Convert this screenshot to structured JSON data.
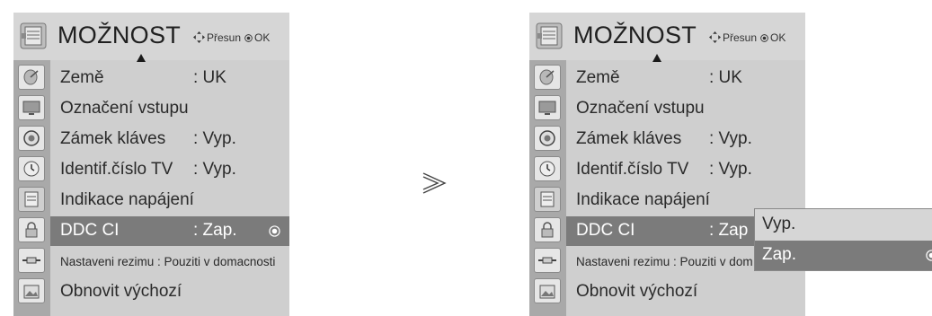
{
  "left_menu": {
    "title": "MOŽNOST",
    "hint_move": "Přesun",
    "hint_ok": "OK",
    "rows": [
      {
        "label": "Země",
        "value": ": UK"
      },
      {
        "label": "Označení vstupu",
        "value": ""
      },
      {
        "label": "Zámek kláves",
        "value": ": Vyp."
      },
      {
        "label": "Identif.číslo TV",
        "value": ": Vyp."
      },
      {
        "label": "Indikace napájení",
        "value": ""
      },
      {
        "label": "DDC CI",
        "value": ": Zap."
      },
      {
        "label": "Nastaveni rezimu : Pouziti v domacnosti",
        "value": ""
      },
      {
        "label": "Obnovit výchozí",
        "value": ""
      }
    ]
  },
  "right_menu": {
    "title": "MOŽNOST",
    "hint_move": "Přesun",
    "hint_ok": "OK",
    "rows": [
      {
        "label": "Země",
        "value": ": UK"
      },
      {
        "label": "Označení vstupu",
        "value": ""
      },
      {
        "label": "Zámek kláves",
        "value": ": Vyp."
      },
      {
        "label": "Identif.číslo TV",
        "value": ": Vyp."
      },
      {
        "label": "Indikace napájení",
        "value": ""
      },
      {
        "label": "DDC CI",
        "value": ": Zap"
      },
      {
        "label": "Nastaveni rezimu : Pouziti v dom",
        "value": ""
      },
      {
        "label": "Obnovit výchozí",
        "value": ""
      }
    ],
    "dropdown": {
      "options": [
        "Vyp.",
        "Zap."
      ],
      "selected": "Zap."
    }
  },
  "transition_glyph": "next-step-chevron-icon",
  "colors": {
    "panel": "#cfcfcf",
    "icon_column": "#a9a9a9",
    "selected_row": "#7b7b7b",
    "selected_text": "#ffffff"
  }
}
